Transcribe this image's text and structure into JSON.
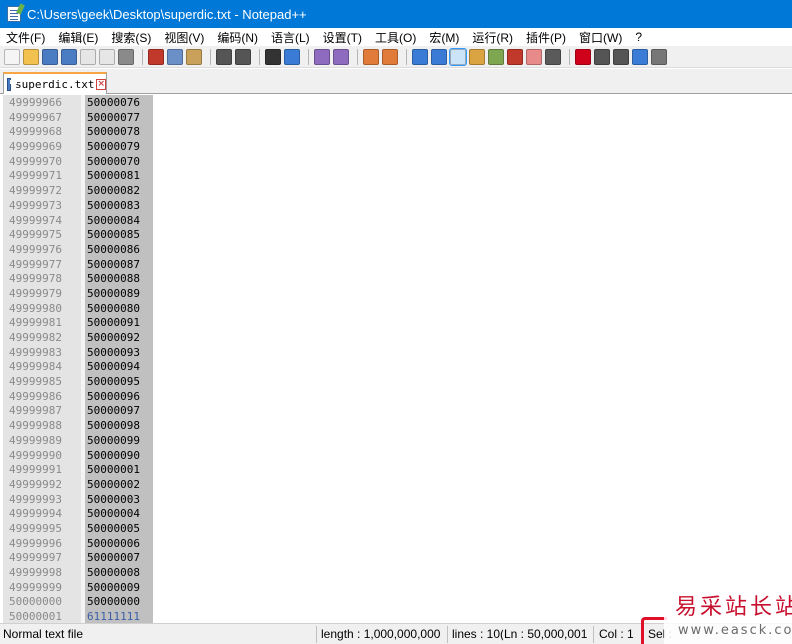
{
  "window": {
    "title": "C:\\Users\\geek\\Desktop\\superdic.txt - Notepad++"
  },
  "menu": [
    "文件(F)",
    "编辑(E)",
    "搜索(S)",
    "视图(V)",
    "编码(N)",
    "语言(L)",
    "设置(T)",
    "工具(O)",
    "宏(M)",
    "运行(R)",
    "插件(P)",
    "窗口(W)",
    "?"
  ],
  "toolbar": {
    "buttons": [
      {
        "icon": "new-file-icon",
        "color": "#f5f5f5"
      },
      {
        "icon": "open-file-icon",
        "color": "#f2c14e"
      },
      {
        "icon": "save-icon",
        "color": "#4a7cc3"
      },
      {
        "icon": "save-all-icon",
        "color": "#4a7cc3"
      },
      {
        "icon": "close-file-icon",
        "color": "#e6e6e6"
      },
      {
        "icon": "close-all-icon",
        "color": "#e6e6e6"
      },
      {
        "icon": "print-icon",
        "color": "#8a8a8a"
      },
      {
        "icon": "sep"
      },
      {
        "icon": "cut-icon",
        "color": "#c0392b"
      },
      {
        "icon": "copy-icon",
        "color": "#6b8fc7"
      },
      {
        "icon": "paste-icon",
        "color": "#c9a15a"
      },
      {
        "icon": "sep"
      },
      {
        "icon": "undo-icon",
        "color": "#555555"
      },
      {
        "icon": "redo-icon",
        "color": "#555555"
      },
      {
        "icon": "sep"
      },
      {
        "icon": "find-icon",
        "color": "#333333"
      },
      {
        "icon": "replace-icon",
        "color": "#3a7bd5"
      },
      {
        "icon": "sep"
      },
      {
        "icon": "zoom-in-icon",
        "color": "#8e6bbf"
      },
      {
        "icon": "zoom-out-icon",
        "color": "#8e6bbf"
      },
      {
        "icon": "sep"
      },
      {
        "icon": "sync-vertical-icon",
        "color": "#e07b39"
      },
      {
        "icon": "sync-horizontal-icon",
        "color": "#e07b39"
      },
      {
        "icon": "sep"
      },
      {
        "icon": "word-wrap-icon",
        "color": "#3a7bd5"
      },
      {
        "icon": "show-all-chars-icon",
        "color": "#3a7bd5"
      },
      {
        "icon": "indent-guide-icon",
        "color": "#3a7bd5",
        "active": true
      },
      {
        "icon": "user-lang-icon",
        "color": "#d9a441"
      },
      {
        "icon": "doc-map-icon",
        "color": "#7fa650"
      },
      {
        "icon": "function-list-icon",
        "color": "#c0392b"
      },
      {
        "icon": "folder-workspace-icon",
        "color": "#e88a8a"
      },
      {
        "icon": "monitor-icon",
        "color": "#5a5a5a"
      },
      {
        "icon": "sep"
      },
      {
        "icon": "record-macro-icon",
        "color": "#d0021b"
      },
      {
        "icon": "stop-record-icon",
        "color": "#555555"
      },
      {
        "icon": "play-macro-icon",
        "color": "#555555"
      },
      {
        "icon": "run-macro-multiple-icon",
        "color": "#3a7bd5"
      },
      {
        "icon": "save-macro-icon",
        "color": "#777777"
      }
    ]
  },
  "tab": {
    "label": "superdic.txt"
  },
  "editor": {
    "lines": [
      {
        "ln": "49999966",
        "text": "50000076"
      },
      {
        "ln": "49999967",
        "text": "50000077"
      },
      {
        "ln": "49999968",
        "text": "50000078"
      },
      {
        "ln": "49999969",
        "text": "50000079"
      },
      {
        "ln": "49999970",
        "text": "50000070"
      },
      {
        "ln": "49999971",
        "text": "50000081"
      },
      {
        "ln": "49999972",
        "text": "50000082"
      },
      {
        "ln": "49999973",
        "text": "50000083"
      },
      {
        "ln": "49999974",
        "text": "50000084"
      },
      {
        "ln": "49999975",
        "text": "50000085"
      },
      {
        "ln": "49999976",
        "text": "50000086"
      },
      {
        "ln": "49999977",
        "text": "50000087"
      },
      {
        "ln": "49999978",
        "text": "50000088"
      },
      {
        "ln": "49999979",
        "text": "50000089"
      },
      {
        "ln": "49999980",
        "text": "50000080"
      },
      {
        "ln": "49999981",
        "text": "50000091"
      },
      {
        "ln": "49999982",
        "text": "50000092"
      },
      {
        "ln": "49999983",
        "text": "50000093"
      },
      {
        "ln": "49999984",
        "text": "50000094"
      },
      {
        "ln": "49999985",
        "text": "50000095"
      },
      {
        "ln": "49999986",
        "text": "50000096"
      },
      {
        "ln": "49999987",
        "text": "50000097"
      },
      {
        "ln": "49999988",
        "text": "50000098"
      },
      {
        "ln": "49999989",
        "text": "50000099"
      },
      {
        "ln": "49999990",
        "text": "50000090"
      },
      {
        "ln": "49999991",
        "text": "50000001"
      },
      {
        "ln": "49999992",
        "text": "50000002"
      },
      {
        "ln": "49999993",
        "text": "50000003"
      },
      {
        "ln": "49999994",
        "text": "50000004"
      },
      {
        "ln": "49999995",
        "text": "50000005"
      },
      {
        "ln": "49999996",
        "text": "50000006"
      },
      {
        "ln": "49999997",
        "text": "50000007"
      },
      {
        "ln": "49999998",
        "text": "50000008"
      },
      {
        "ln": "49999999",
        "text": "50000009"
      },
      {
        "ln": "50000000",
        "text": "50000000"
      },
      {
        "ln": "50000001",
        "text": "61111111"
      }
    ]
  },
  "status": {
    "file_type": "Normal text file",
    "length": "length : 1,000,000,000",
    "lines": "lines : 10(",
    "ln": "Ln : 50,000,001",
    "col": "Col : 1",
    "sel": "Sel :"
  },
  "watermark": {
    "main": "易采站长站",
    "sub": "www.easck.com"
  }
}
